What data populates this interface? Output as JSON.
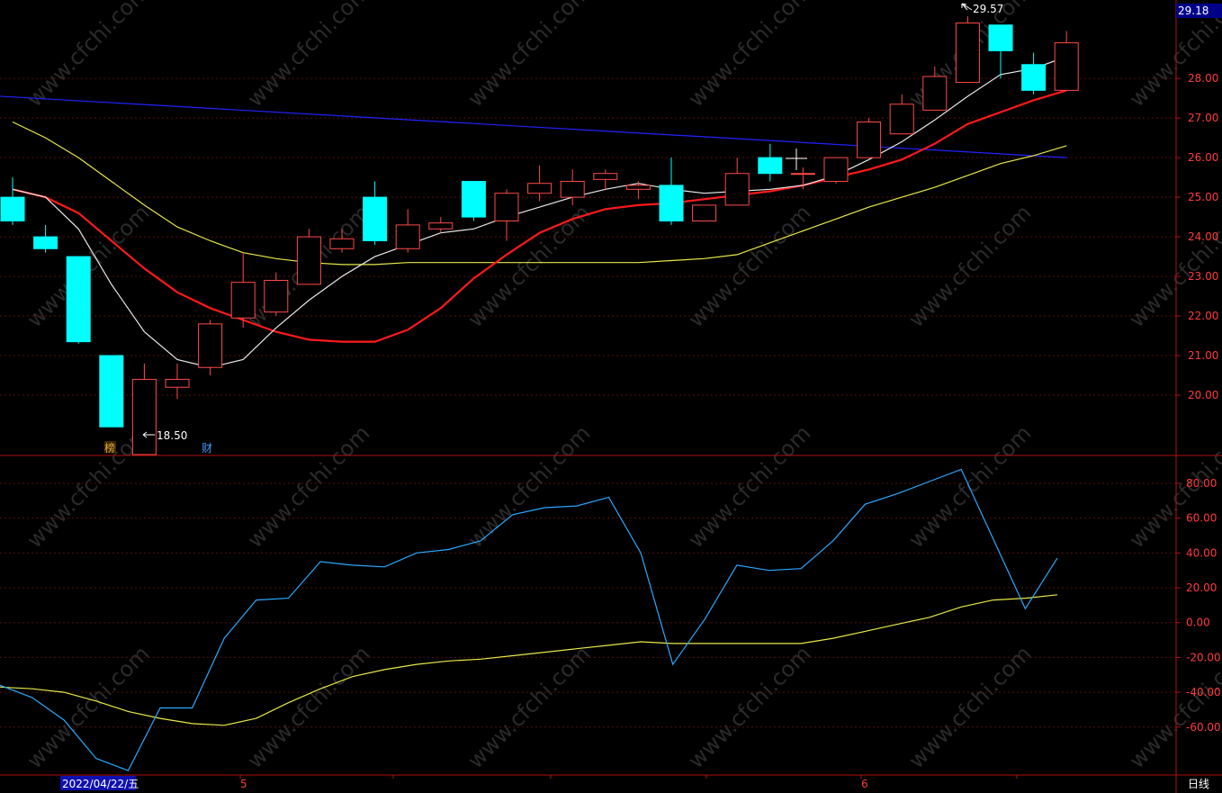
{
  "colors": {
    "background": "#000000",
    "axis": "#b01010",
    "grid": "#5a0e0e",
    "axis_text": "#ff3b3b",
    "up_candle": "#ff4a4a",
    "down_candle": "#00ffff",
    "ma_white": "#e8e8e8",
    "ma_red": "#ff1a1a",
    "ma_yellow": "#e8e84a",
    "ma_blue": "#2222ff",
    "osc_line": "#2aa8ff",
    "osc_signal": "#e8e84a",
    "price_tag_bg": "#000088",
    "date_tag_bg": "#1010b0"
  },
  "watermark": "www.cfchi.com",
  "current_price_tag": "29.18",
  "labels": {
    "high": "29.57",
    "low": "18.50",
    "period": "日线",
    "date": "2022/04/22/五",
    "month_5": "5",
    "month_6": "6",
    "badge_bang": "榜",
    "badge_cai": "财"
  },
  "chart_data": [
    {
      "type": "candlestick",
      "title": "",
      "ylim": [
        19.0,
        29.8
      ],
      "y_ticks": [
        "20.00",
        "21.00",
        "22.00",
        "23.00",
        "24.00",
        "25.00",
        "26.00",
        "27.00",
        "28.00"
      ],
      "grid": true,
      "candles": [
        {
          "o": 25.0,
          "h": 25.5,
          "l": 24.3,
          "c": 24.4
        },
        {
          "o": 24.0,
          "h": 24.3,
          "l": 23.6,
          "c": 23.7
        },
        {
          "o": 23.5,
          "h": 23.5,
          "l": 21.3,
          "c": 21.35
        },
        {
          "o": 21.0,
          "h": 21.0,
          "l": 19.2,
          "c": 19.2
        },
        {
          "o": 18.5,
          "h": 20.8,
          "l": 18.5,
          "c": 20.4
        },
        {
          "o": 20.2,
          "h": 20.8,
          "l": 19.9,
          "c": 20.4
        },
        {
          "o": 20.7,
          "h": 21.9,
          "l": 20.5,
          "c": 21.8
        },
        {
          "o": 21.95,
          "h": 23.6,
          "l": 21.7,
          "c": 22.85
        },
        {
          "o": 22.1,
          "h": 23.1,
          "l": 22.0,
          "c": 22.9
        },
        {
          "o": 22.8,
          "h": 24.2,
          "l": 22.8,
          "c": 24.0
        },
        {
          "o": 23.7,
          "h": 24.2,
          "l": 23.6,
          "c": 23.95
        },
        {
          "o": 25.0,
          "h": 25.4,
          "l": 23.8,
          "c": 23.9
        },
        {
          "o": 23.7,
          "h": 24.7,
          "l": 23.6,
          "c": 24.3
        },
        {
          "o": 24.2,
          "h": 24.5,
          "l": 24.1,
          "c": 24.35
        },
        {
          "o": 25.4,
          "h": 25.4,
          "l": 24.4,
          "c": 24.5
        },
        {
          "o": 24.4,
          "h": 25.2,
          "l": 23.9,
          "c": 25.1
        },
        {
          "o": 25.1,
          "h": 25.8,
          "l": 24.9,
          "c": 25.35
        },
        {
          "o": 25.0,
          "h": 25.7,
          "l": 24.8,
          "c": 25.4
        },
        {
          "o": 25.45,
          "h": 25.7,
          "l": 25.2,
          "c": 25.6
        },
        {
          "o": 25.2,
          "h": 25.4,
          "l": 24.95,
          "c": 25.3
        },
        {
          "o": 25.3,
          "h": 26.0,
          "l": 24.3,
          "c": 24.4
        },
        {
          "o": 24.4,
          "h": 24.8,
          "l": 24.4,
          "c": 24.8
        },
        {
          "o": 24.8,
          "h": 26.0,
          "l": 24.8,
          "c": 25.6
        },
        {
          "o": 26.0,
          "h": 26.35,
          "l": 25.4,
          "c": 25.6
        },
        {
          "o": 25.6,
          "h": 25.75,
          "l": 25.2,
          "c": 25.6
        },
        {
          "o": 25.4,
          "h": 26.0,
          "l": 25.35,
          "c": 26.0
        },
        {
          "o": 26.0,
          "h": 27.0,
          "l": 26.0,
          "c": 26.9
        },
        {
          "o": 26.6,
          "h": 27.6,
          "l": 26.6,
          "c": 27.35
        },
        {
          "o": 27.2,
          "h": 28.3,
          "l": 27.2,
          "c": 28.05
        },
        {
          "o": 27.9,
          "h": 29.57,
          "l": 27.9,
          "c": 29.4
        },
        {
          "o": 29.35,
          "h": 29.35,
          "l": 28.0,
          "c": 28.7
        },
        {
          "o": 28.35,
          "h": 28.65,
          "l": 27.6,
          "c": 27.7
        },
        {
          "o": 27.7,
          "h": 29.2,
          "l": 27.7,
          "c": 28.9
        }
      ],
      "ma_white": [
        25.2,
        25.0,
        24.2,
        22.8,
        21.6,
        20.9,
        20.7,
        20.9,
        21.7,
        22.4,
        23.0,
        23.5,
        23.8,
        24.1,
        24.2,
        24.5,
        24.75,
        25.0,
        25.2,
        25.35,
        25.2,
        25.1,
        25.15,
        25.2,
        25.3,
        25.55,
        25.95,
        26.4,
        26.95,
        27.55,
        28.1,
        28.25,
        28.55
      ],
      "ma_red": [
        25.2,
        25.0,
        24.6,
        23.9,
        23.2,
        22.6,
        22.2,
        21.9,
        21.6,
        21.4,
        21.35,
        21.35,
        21.65,
        22.2,
        22.95,
        23.55,
        24.1,
        24.45,
        24.7,
        24.8,
        24.85,
        24.95,
        25.05,
        25.15,
        25.3,
        25.5,
        25.7,
        25.95,
        26.35,
        26.85,
        27.15,
        27.45,
        27.7
      ],
      "ma_yellow": [
        26.9,
        26.5,
        26.0,
        25.4,
        24.8,
        24.25,
        23.9,
        23.6,
        23.45,
        23.35,
        23.3,
        23.3,
        23.35,
        23.35,
        23.35,
        23.35,
        23.35,
        23.35,
        23.35,
        23.35,
        23.4,
        23.45,
        23.55,
        23.85,
        24.15,
        24.45,
        24.75,
        25.0,
        25.25,
        25.55,
        25.85,
        26.05,
        26.3
      ],
      "ma_blue": {
        "start": 27.55,
        "end": 26.0
      }
    },
    {
      "type": "line",
      "title": "",
      "ylim": [
        -87,
        96
      ],
      "y_ticks": [
        "-60.00",
        "-40.00",
        "-20.00",
        "0.00",
        "20.00",
        "40.00",
        "60.00",
        "80.00"
      ],
      "grid": true,
      "series": [
        {
          "values": [
            -36,
            -43,
            -56,
            -78,
            -85,
            -49,
            -49,
            -9,
            13,
            14,
            35,
            33,
            32,
            40,
            42,
            47,
            62,
            66,
            67,
            72,
            40,
            -24,
            2,
            33,
            30,
            31,
            47,
            68,
            74,
            81,
            88,
            48,
            8,
            37
          ]
        },
        {
          "values": [
            -37,
            -38,
            -40,
            -45,
            -51,
            -55,
            -58,
            -59,
            -55,
            -46,
            -38,
            -31,
            -27,
            -24,
            -22,
            -21,
            -19,
            -17,
            -15,
            -13,
            -11,
            -12,
            -12,
            -12,
            -12,
            -12,
            -9,
            -5,
            -1,
            3,
            9,
            13,
            14,
            16
          ]
        }
      ]
    }
  ]
}
